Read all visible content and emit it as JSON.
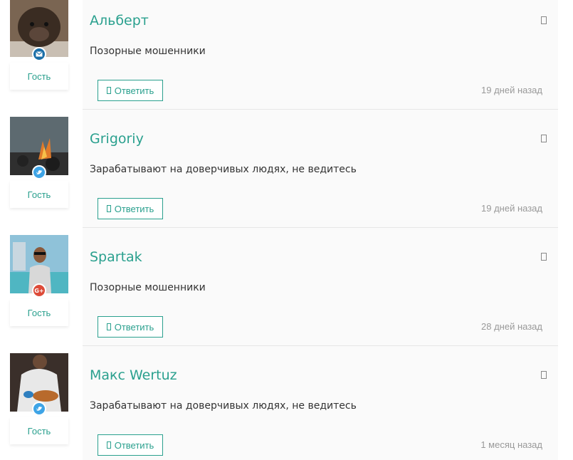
{
  "theme": {
    "accent": "#2aa08e",
    "panel_bg": "#fafafa",
    "muted": "#999999"
  },
  "comments": [
    {
      "author": "Альберт",
      "text": "Позорные мошенники",
      "reply_label": "Ответить",
      "time": "19 дней назад",
      "user_type": "Гость",
      "social": "mail-icon"
    },
    {
      "author": "Grigoriy",
      "text": "Зарабатывают на доверчивых людях, не ведитесь",
      "reply_label": "Ответить",
      "time": "19 дней назад",
      "user_type": "Гость",
      "social": "twitter-icon"
    },
    {
      "author": "Spartak",
      "text": "Позорные мошенники",
      "reply_label": "Ответить",
      "time": "28 дней назад",
      "user_type": "Гость",
      "social": "google-plus-icon",
      "social_text": "G+"
    },
    {
      "author": "Макс Wertuz",
      "text": "Зарабатывают на доверчивых людях, не ведитесь",
      "reply_label": "Ответить",
      "time": "1 месяц назад",
      "user_type": "Гость",
      "social": "twitter-icon"
    }
  ]
}
